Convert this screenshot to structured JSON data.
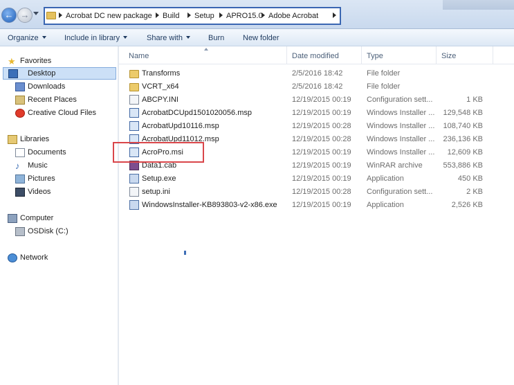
{
  "address": {
    "crumbs": [
      "Acrobat DC new package",
      "Build",
      "Setup",
      "APRO15.0",
      "Adobe Acrobat"
    ]
  },
  "toolbar": {
    "organize": "Organize",
    "include_in_library": "Include in library",
    "share_with": "Share with",
    "burn": "Burn",
    "new_folder": "New folder"
  },
  "nav": {
    "favorites_header": "Favorites",
    "favorites": [
      "Desktop",
      "Downloads",
      "Recent Places",
      "Creative Cloud Files"
    ],
    "libraries_header": "Libraries",
    "libraries": [
      "Documents",
      "Music",
      "Pictures",
      "Videos"
    ],
    "computer_header": "Computer",
    "computer": [
      "OSDisk (C:)"
    ],
    "network_header": "Network",
    "selected": "Desktop"
  },
  "columns": {
    "name": "Name",
    "date": "Date modified",
    "type": "Type",
    "size": "Size"
  },
  "files": [
    {
      "name": "Transforms",
      "date": "2/5/2016 18:42",
      "type": "File folder",
      "size": "",
      "icon": "folder-icon"
    },
    {
      "name": "VCRT_x64",
      "date": "2/5/2016 18:42",
      "type": "File folder",
      "size": "",
      "icon": "folder-icon"
    },
    {
      "name": "ABCPY.INI",
      "date": "12/19/2015 00:19",
      "type": "Configuration sett...",
      "size": "1 KB",
      "icon": "ini-file-icon"
    },
    {
      "name": "AcrobatDCUpd1501020056.msp",
      "date": "12/19/2015 00:19",
      "type": "Windows Installer ...",
      "size": "129,548 KB",
      "icon": "msp-file-icon"
    },
    {
      "name": "AcrobatUpd10116.msp",
      "date": "12/19/2015 00:28",
      "type": "Windows Installer ...",
      "size": "108,740 KB",
      "icon": "msp-file-icon"
    },
    {
      "name": "AcrobatUpd11012.msp",
      "date": "12/19/2015 00:28",
      "type": "Windows Installer ...",
      "size": "236,136 KB",
      "icon": "msp-file-icon"
    },
    {
      "name": "AcroPro.msi",
      "date": "12/19/2015 00:19",
      "type": "Windows Installer ...",
      "size": "12,609 KB",
      "icon": "msi-file-icon"
    },
    {
      "name": "Data1.cab",
      "date": "12/19/2015 00:19",
      "type": "WinRAR archive",
      "size": "553,886 KB",
      "icon": "cab-file-icon"
    },
    {
      "name": "Setup.exe",
      "date": "12/19/2015 00:19",
      "type": "Application",
      "size": "450 KB",
      "icon": "exe-file-icon"
    },
    {
      "name": "setup.ini",
      "date": "12/19/2015 00:28",
      "type": "Configuration sett...",
      "size": "2 KB",
      "icon": "ini-file-icon"
    },
    {
      "name": "WindowsInstaller-KB893803-v2-x86.exe",
      "date": "12/19/2015 00:19",
      "type": "Application",
      "size": "2,526 KB",
      "icon": "exe-file-icon"
    }
  ],
  "colors": {
    "highlight": "#d9464a",
    "address_outline": "#3a66b2",
    "nav_selected": "#cce0f7"
  }
}
